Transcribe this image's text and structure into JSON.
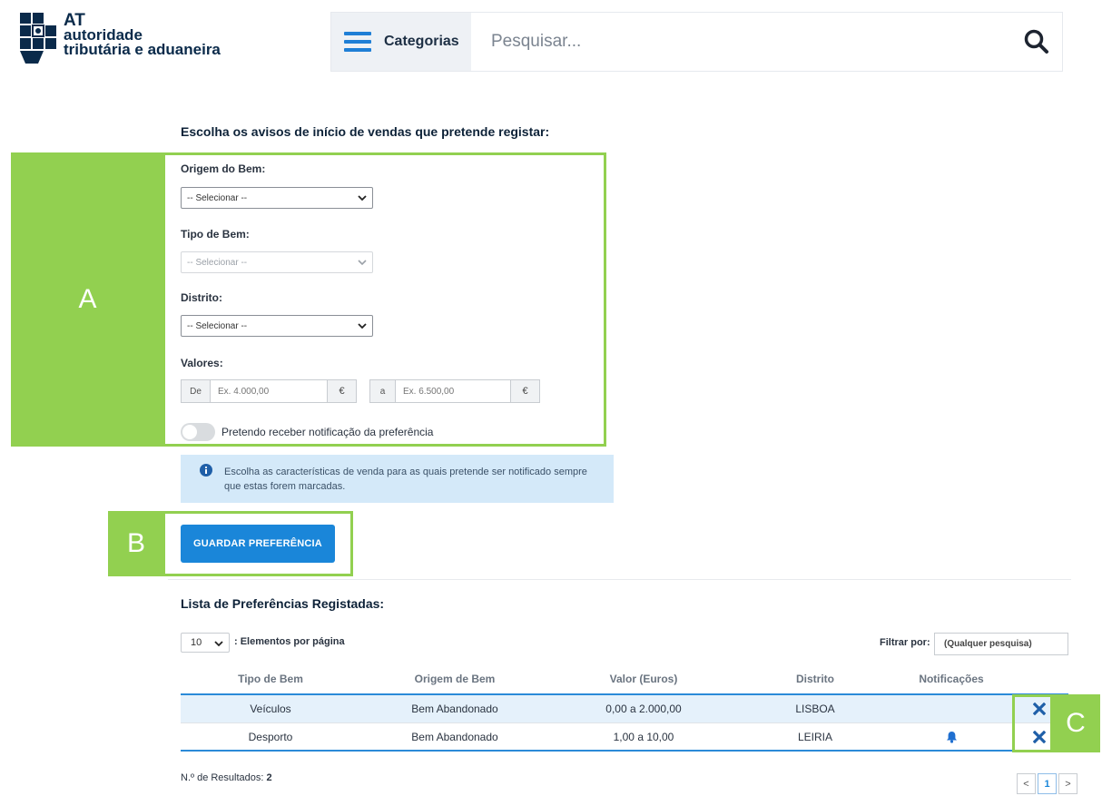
{
  "header": {
    "logo": {
      "line1": "AT",
      "line2": "autoridade",
      "line3": "tributária e aduaneira"
    },
    "categories_label": "Categorias",
    "search_placeholder": "Pesquisar..."
  },
  "form": {
    "title": "Escolha os avisos de início de vendas que pretende registar:",
    "origem_label": "Origem do Bem:",
    "origem_value": "-- Selecionar --",
    "tipo_label": "Tipo de Bem:",
    "tipo_value": "-- Selecionar --",
    "distrito_label": "Distrito:",
    "distrito_value": "-- Selecionar --",
    "valores_label": "Valores:",
    "from_prefix": "De",
    "from_placeholder": "Ex. 4.000,00",
    "to_prefix": "a",
    "to_placeholder": "Ex. 6.500,00",
    "currency": "€",
    "notify_label": "Pretendo receber notificação da preferência",
    "info_text": "Escolha as características de venda para as quais pretende ser notificado sempre que estas forem marcadas.",
    "save_label": "GUARDAR PREFERÊNCIA"
  },
  "list": {
    "title": "Lista de Preferências Registadas:",
    "page_size": "10",
    "page_size_label": ": Elementos por página",
    "filter_label": "Filtrar por:",
    "filter_placeholder": "(Qualquer pesquisa)",
    "columns": [
      "Tipo de Bem",
      "Origem de Bem",
      "Valor (Euros)",
      "Distrito",
      "Notificações"
    ],
    "rows": [
      {
        "tipo": "Veículos",
        "origem": "Bem Abandonado",
        "valor": "0,00 a 2.000,00",
        "distrito": "LISBOA",
        "notificacao": false
      },
      {
        "tipo": "Desporto",
        "origem": "Bem Abandonado",
        "valor": "1,00 a 10,00",
        "distrito": "LEIRIA",
        "notificacao": true
      }
    ],
    "results_label": "N.º de Resultados:",
    "results_count": "2",
    "pagination": {
      "prev": "<",
      "current": "1",
      "next": ">"
    }
  },
  "annotations": {
    "a": "A",
    "b": "B",
    "c": "C"
  },
  "colors": {
    "annotation": "#92d050",
    "primary": "#1a86d9",
    "info_bg": "#d4e9f9",
    "navy": "#0d2238"
  }
}
